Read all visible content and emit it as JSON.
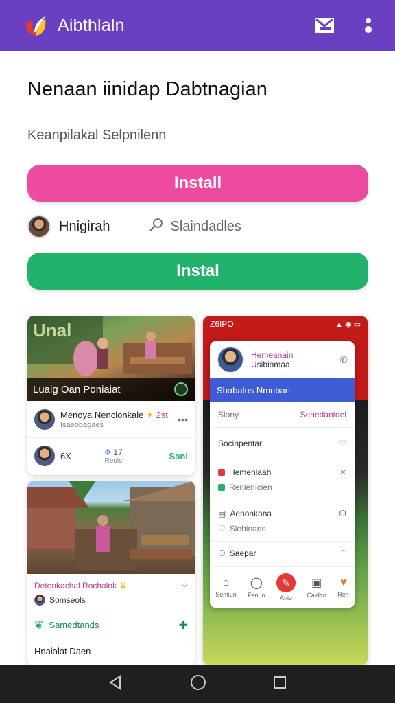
{
  "app": {
    "title": "Aibthlaln",
    "brand_color": "#6a3fc0"
  },
  "hero": {
    "headline": "Nenaan iinidap Dabtnagian",
    "subhead": "Keanpilakal Selpnilenn"
  },
  "buttons": {
    "primary_label": "Install",
    "secondary_label": "Instal",
    "primary_color": "#ec4ba0",
    "secondary_color": "#20b26a"
  },
  "meta": {
    "user_name": "Hnigirah",
    "link_label": "Slaindadles"
  },
  "feed": {
    "card_a": {
      "photo_caption": "Luaig Oan Poniaiat",
      "author": "Menoya Nenclonkale",
      "author_tag": "2st",
      "sub": "Isaeobagaes",
      "stat_count": "6X",
      "react_count": "17",
      "react_label": "Reuls",
      "action_label": "Sani"
    },
    "card_b": {
      "title": "Detenkachal Rochalok",
      "user": "Somseols",
      "section": "Samedtands",
      "footer": "Hnaialat Daen"
    }
  },
  "phone": {
    "status_time": "Z6IPO",
    "profile_name": "Hemeanain",
    "profile_sub": "Usibiomaa",
    "blue_bar": "Sbabalns Nmnban",
    "filter_left": "Slony",
    "filter_right": "Senedantdel",
    "rows": [
      {
        "label": "Socinpentar",
        "sub": ""
      },
      {
        "label": "Hemenlaah",
        "sub": "Renlenicien"
      },
      {
        "label": "Aenonkana",
        "sub": "Slebinans"
      }
    ],
    "search_label": "Saepar",
    "nav": [
      "Semiun",
      "Fenuo",
      "Anio",
      "Caidon",
      "Ren"
    ]
  },
  "system_nav": [
    "back",
    "home",
    "recents"
  ]
}
